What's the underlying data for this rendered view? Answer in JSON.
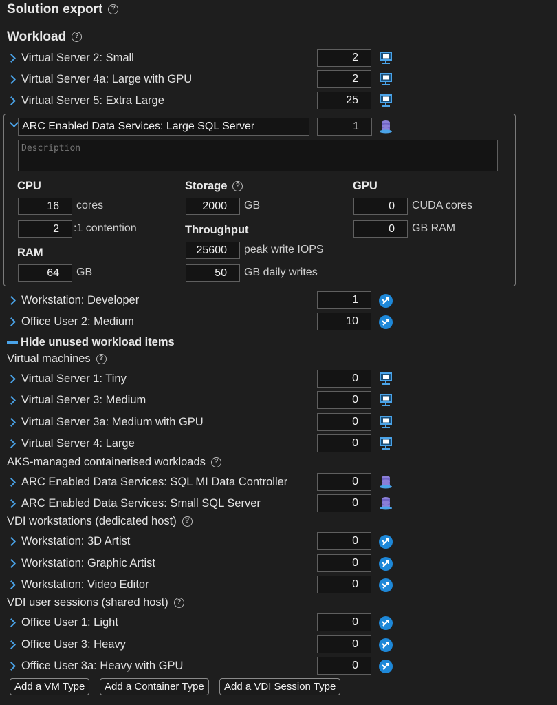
{
  "header": {
    "title": "Solution export"
  },
  "workload": {
    "title": "Workload",
    "active_items": [
      {
        "label": "Virtual Server 2: Small",
        "count": "2",
        "icon": "monitor-icon"
      },
      {
        "label": "Virtual Server 4a: Large with GPU",
        "count": "2",
        "icon": "monitor-icon"
      },
      {
        "label": "Virtual Server 5: Extra Large",
        "count": "25",
        "icon": "monitor-icon"
      }
    ],
    "expanded": {
      "name": "ARC Enabled Data Services: Large SQL Server",
      "count": "1",
      "icon": "database-icon",
      "description_placeholder": "Description",
      "cpu": {
        "heading": "CPU",
        "cores": "16",
        "cores_unit": "cores",
        "contention": "2",
        "contention_unit": ":1 contention"
      },
      "ram": {
        "heading": "RAM",
        "value": "64",
        "unit": "GB"
      },
      "storage": {
        "heading": "Storage",
        "value": "2000",
        "unit": "GB"
      },
      "throughput": {
        "heading": "Throughput",
        "iops": "25600",
        "iops_unit": "peak write IOPS",
        "daily": "50",
        "daily_unit": "GB daily writes"
      },
      "gpu": {
        "heading": "GPU",
        "cuda": "0",
        "cuda_unit": "CUDA cores",
        "ram": "0",
        "ram_unit": "GB RAM"
      }
    },
    "after_items": [
      {
        "label": "Workstation: Developer",
        "count": "1",
        "icon": "remote-desktop-icon"
      },
      {
        "label": "Office User 2: Medium",
        "count": "10",
        "icon": "remote-desktop-icon"
      }
    ],
    "hide_unused_label": "Hide unused workload items"
  },
  "unused": {
    "vm": {
      "title": "Virtual machines",
      "items": [
        {
          "label": "Virtual Server 1: Tiny",
          "count": "0"
        },
        {
          "label": "Virtual Server 3: Medium",
          "count": "0"
        },
        {
          "label": "Virtual Server 3a: Medium with GPU",
          "count": "0"
        },
        {
          "label": "Virtual Server 4: Large",
          "count": "0"
        }
      ]
    },
    "aks": {
      "title": "AKS-managed containerised workloads",
      "items": [
        {
          "label": "ARC Enabled Data Services: SQL MI Data Controller",
          "count": "0"
        },
        {
          "label": "ARC Enabled Data Services: Small SQL Server",
          "count": "0"
        }
      ]
    },
    "vdi_dedicated": {
      "title": "VDI workstations (dedicated host)",
      "items": [
        {
          "label": "Workstation: 3D Artist",
          "count": "0"
        },
        {
          "label": "Workstation: Graphic Artist",
          "count": "0"
        },
        {
          "label": "Workstation: Video Editor",
          "count": "0"
        }
      ]
    },
    "vdi_shared": {
      "title": "VDI user sessions (shared host)",
      "items": [
        {
          "label": "Office User 1: Light",
          "count": "0"
        },
        {
          "label": "Office User 3: Heavy",
          "count": "0"
        },
        {
          "label": "Office User 3a: Heavy with GPU",
          "count": "0"
        }
      ]
    }
  },
  "buttons": {
    "add_vm": "Add a VM Type",
    "add_container": "Add a Container Type",
    "add_vdi": "Add a VDI Session Type"
  },
  "colors": {
    "accent": "#4aa3e8",
    "background": "#1e1e1e",
    "container_icon": "#8a7fd8"
  }
}
